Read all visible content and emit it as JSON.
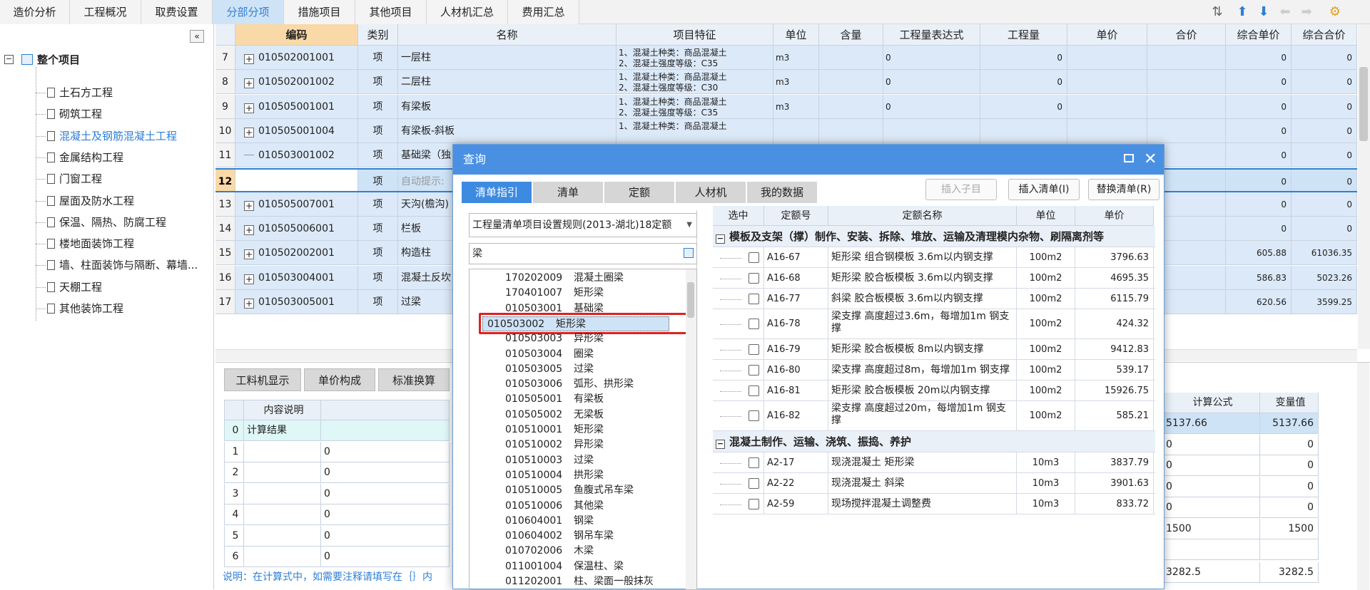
{
  "topbar": {
    "tabs": [
      "造价分析",
      "工程概况",
      "取费设置",
      "分部分项",
      "措施项目",
      "其他项目",
      "人材机汇总",
      "费用汇总"
    ],
    "active_tab": "分部分项"
  },
  "sidebar": {
    "root": "整个项目",
    "items": [
      "土石方工程",
      "砌筑工程",
      "混凝土及钢筋混凝土工程",
      "金属结构工程",
      "门窗工程",
      "屋面及防水工程",
      "保温、隔热、防腐工程",
      "楼地面装饰工程",
      "墙、柱面装饰与隔断、幕墙...",
      "天棚工程",
      "其他装饰工程"
    ],
    "selected_index": 2,
    "collapse_label": "«"
  },
  "grid": {
    "headers": [
      "编码",
      "类别",
      "名称",
      "项目特征",
      "单位",
      "含量",
      "工程量表达式",
      "工程量",
      "单价",
      "合价",
      "综合单价",
      "综合合价"
    ],
    "rows": [
      {
        "n": "7",
        "code": "010502001001",
        "type": "项",
        "name": "一层柱",
        "feat": "1、混凝土种类：商品混凝土\n2、混凝土强度等级：C35",
        "unit": "m3",
        "expr": "0",
        "qty": "0",
        "uprice": "0",
        "total": "0"
      },
      {
        "n": "8",
        "code": "010502001002",
        "type": "项",
        "name": "二层柱",
        "feat": "1、混凝土种类：商品混凝土\n2、混凝土强度等级：C30",
        "unit": "m3",
        "expr": "0",
        "qty": "0",
        "uprice": "0",
        "total": "0"
      },
      {
        "n": "9",
        "code": "010505001001",
        "type": "项",
        "name": "有梁板",
        "feat": "1、混凝土种类：商品混凝土\n2、混凝土强度等级：C35",
        "unit": "m3",
        "expr": "0",
        "qty": "0",
        "uprice": "0",
        "total": "0"
      },
      {
        "n": "10",
        "code": "010505001004",
        "type": "项",
        "name": "有梁板-斜板",
        "feat": "1、混凝土种类：商品混凝土",
        "unit": "",
        "expr": "",
        "qty": "",
        "uprice": "0",
        "total": "0"
      },
      {
        "n": "11",
        "code": "010503001002",
        "type": "项",
        "name": "基础梁（独",
        "feat": "",
        "unit": "",
        "expr": "",
        "qty": "",
        "uprice": "0",
        "total": "0"
      },
      {
        "n": "12",
        "code": "",
        "type": "项",
        "name": "自动提示:",
        "feat": "",
        "unit": "",
        "expr": "",
        "qty": "",
        "uprice": "0",
        "total": "0"
      },
      {
        "n": "13",
        "code": "010505007001",
        "type": "项",
        "name": "天沟(檐沟)",
        "feat": "",
        "unit": "",
        "expr": "",
        "qty": "",
        "uprice": "0",
        "total": "0"
      },
      {
        "n": "14",
        "code": "010505006001",
        "type": "项",
        "name": "栏板",
        "feat": "",
        "unit": "",
        "expr": "",
        "qty": "",
        "uprice": "0",
        "total": "0"
      },
      {
        "n": "15",
        "code": "010502002001",
        "type": "项",
        "name": "构造柱",
        "feat": "",
        "unit": "",
        "expr": "",
        "qty": "",
        "uprice": "605.88",
        "total": "61036.35"
      },
      {
        "n": "16",
        "code": "010503004001",
        "type": "项",
        "name": "混凝土反坎",
        "feat": "",
        "unit": "",
        "expr": "",
        "qty": "",
        "uprice": "586.83",
        "total": "5023.26"
      },
      {
        "n": "17",
        "code": "010503005001",
        "type": "项",
        "name": "过梁",
        "feat": "",
        "unit": "",
        "expr": "",
        "qty": "",
        "uprice": "620.56",
        "total": "3599.25"
      }
    ]
  },
  "lower": {
    "tabs": [
      "工料机显示",
      "单价构成",
      "标准换算"
    ],
    "headers": [
      "内容说明",
      "计算公式",
      "变量值"
    ],
    "rows": [
      {
        "n": "0",
        "desc": "计算结果",
        "val": "",
        "formula": "5137.66",
        "var": "5137.66"
      },
      {
        "n": "1",
        "desc": "",
        "val": "0",
        "formula": "0",
        "var": "0"
      },
      {
        "n": "2",
        "desc": "",
        "val": "0",
        "formula": "0",
        "var": "0"
      },
      {
        "n": "3",
        "desc": "",
        "val": "0",
        "formula": "0",
        "var": "0"
      },
      {
        "n": "4",
        "desc": "",
        "val": "0",
        "formula": "0",
        "var": "0"
      },
      {
        "n": "5",
        "desc": "",
        "val": "0",
        "formula": "1500",
        "var": "1500"
      },
      {
        "n": "6",
        "desc": "",
        "val": "0",
        "formula": "",
        "var": ""
      }
    ],
    "note": "说明：在计算式中，如需要注释请填写在｛｝内",
    "extra_formula": "3282.5",
    "extra_var": "3282.5"
  },
  "dialog": {
    "title": "查询",
    "tabs": [
      "清单指引",
      "清单",
      "定额",
      "人材机",
      "我的数据"
    ],
    "active_tab": "清单指引",
    "buttons": {
      "insert_child": "插入子目",
      "insert_list": "插入清单(I)",
      "replace_list": "替换清单(R)"
    },
    "rule_select": "工程量清单项目设置规则(2013-湖北)18定额",
    "search_value": "梁",
    "list": [
      {
        "code": "170202009",
        "name": "混凝土圈梁"
      },
      {
        "code": "170401007",
        "name": "矩形梁"
      },
      {
        "code": "010503001",
        "name": "基础梁"
      },
      {
        "code": "010503002",
        "name": "矩形梁"
      },
      {
        "code": "010503003",
        "name": "异形梁"
      },
      {
        "code": "010503004",
        "name": "圈梁"
      },
      {
        "code": "010503005",
        "name": "过梁"
      },
      {
        "code": "010503006",
        "name": "弧形、拱形梁"
      },
      {
        "code": "010505001",
        "name": "有梁板"
      },
      {
        "code": "010505002",
        "name": "无梁板"
      },
      {
        "code": "010510001",
        "name": "矩形梁"
      },
      {
        "code": "010510002",
        "name": "异形梁"
      },
      {
        "code": "010510003",
        "name": "过梁"
      },
      {
        "code": "010510004",
        "name": "拱形梁"
      },
      {
        "code": "010510005",
        "name": "鱼腹式吊车梁"
      },
      {
        "code": "010510006",
        "name": "其他梁"
      },
      {
        "code": "010604001",
        "name": "钢梁"
      },
      {
        "code": "010604002",
        "name": "钢吊车梁"
      },
      {
        "code": "010702006",
        "name": "木梁"
      },
      {
        "code": "011001004",
        "name": "保温柱、梁"
      },
      {
        "code": "011202001",
        "name": "柱、梁面一般抹灰"
      }
    ],
    "selected_index": 3,
    "right_headers": [
      "选中",
      "定额号",
      "定额名称",
      "单位",
      "单价"
    ],
    "group1": "模板及支架（撑）制作、安装、拆除、堆放、运输及清理模内杂物、刷隔离剂等",
    "group1_rows": [
      {
        "code": "A16-67",
        "name": "矩形梁 组合钢模板 3.6m以内钢支撑",
        "unit": "100m2",
        "price": "3796.63"
      },
      {
        "code": "A16-68",
        "name": "矩形梁 胶合板模板 3.6m以内钢支撑",
        "unit": "100m2",
        "price": "4695.35"
      },
      {
        "code": "A16-77",
        "name": "斜梁 胶合板模板 3.6m以内钢支撑",
        "unit": "100m2",
        "price": "6115.79"
      },
      {
        "code": "A16-78",
        "name": "梁支撑 高度超过3.6m，每增加1m 钢支撑",
        "unit": "100m2",
        "price": "424.32"
      },
      {
        "code": "A16-79",
        "name": "矩形梁 胶合板模板 8m以内钢支撑",
        "unit": "100m2",
        "price": "9412.83"
      },
      {
        "code": "A16-80",
        "name": "梁支撑 高度超过8m，每增加1m 钢支撑",
        "unit": "100m2",
        "price": "539.17"
      },
      {
        "code": "A16-81",
        "name": "矩形梁 胶合板模板 20m以内钢支撑",
        "unit": "100m2",
        "price": "15926.75"
      },
      {
        "code": "A16-82",
        "name": "梁支撑 高度超过20m，每增加1m 钢支撑",
        "unit": "100m2",
        "price": "585.21"
      }
    ],
    "group2": "混凝土制作、运输、浇筑、振捣、养护",
    "group2_rows": [
      {
        "code": "A2-17",
        "name": "现浇混凝土 矩形梁",
        "unit": "10m3",
        "price": "3837.79"
      },
      {
        "code": "A2-22",
        "name": "现浇混凝土 斜梁",
        "unit": "10m3",
        "price": "3901.63"
      },
      {
        "code": "A2-59",
        "name": "现场搅拌混凝土调整费",
        "unit": "10m3",
        "price": "833.72"
      }
    ]
  },
  "colors": {
    "accent": "#4a90e2",
    "highlight": "#e02020",
    "row_bg": "#dce9f8",
    "selected_row": "#cfe3f7"
  }
}
